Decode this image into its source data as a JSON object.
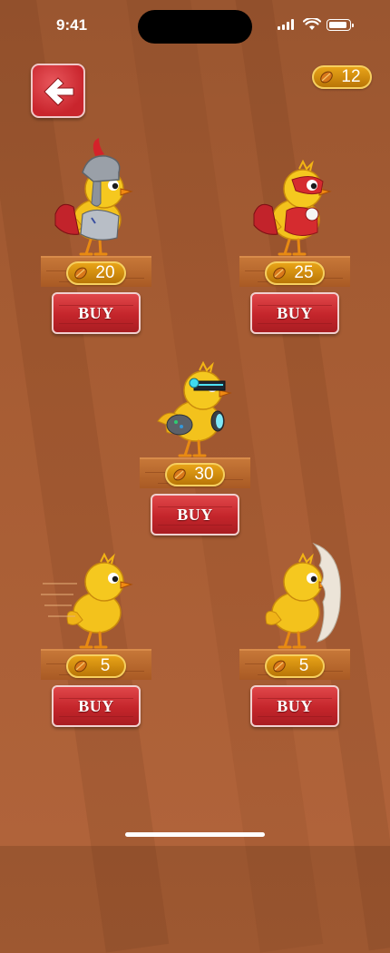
{
  "status_bar": {
    "time": "9:41"
  },
  "header": {
    "coin_balance": "12"
  },
  "shop": {
    "items": [
      {
        "name": "knight",
        "price": "20",
        "buy_label": "BUY"
      },
      {
        "name": "superhero",
        "price": "25",
        "buy_label": "BUY"
      },
      {
        "name": "robot",
        "price": "30",
        "buy_label": "BUY"
      },
      {
        "name": "speedy",
        "price": "5",
        "buy_label": "BUY"
      },
      {
        "name": "hatchling",
        "price": "5",
        "buy_label": "BUY"
      }
    ]
  },
  "colors": {
    "button_red": "#c9252d",
    "coin_gold": "#e8a318",
    "plank_brown": "#b9662c"
  },
  "icons": {
    "back": "arrow-left-icon",
    "coin": "seed-coin-icon"
  }
}
